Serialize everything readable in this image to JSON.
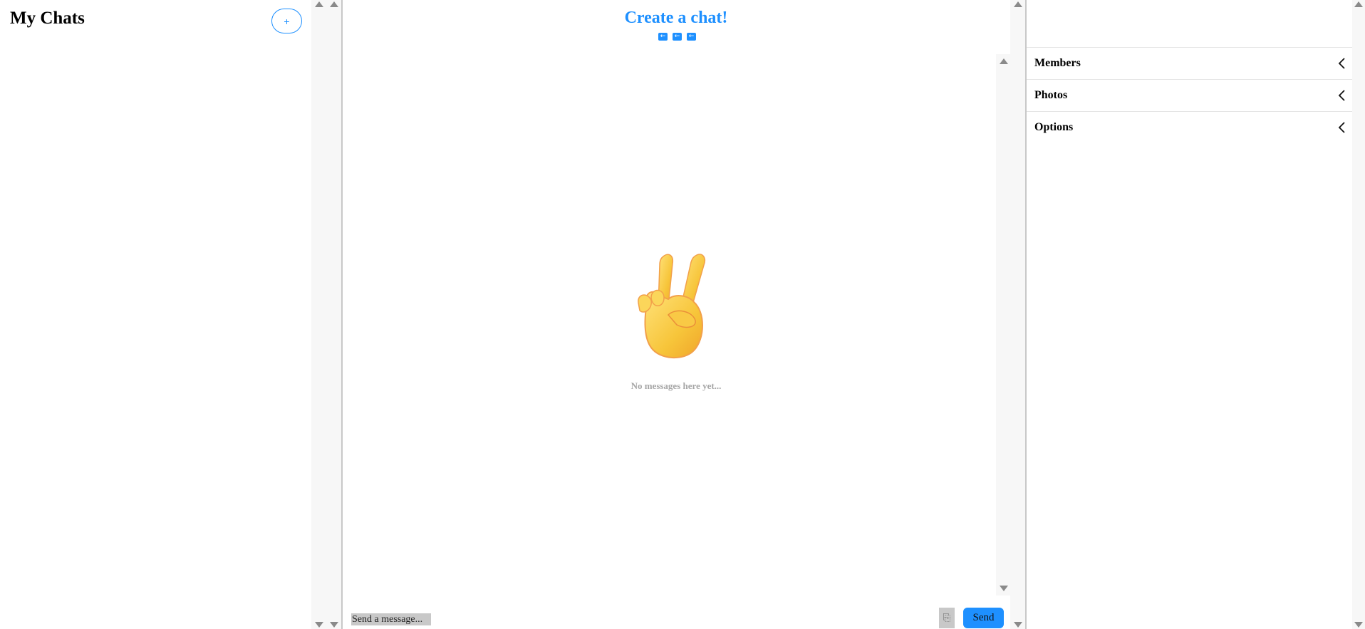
{
  "sidebar": {
    "title": "My Chats",
    "add_label": "+"
  },
  "chat": {
    "title": "Create a chat!",
    "nav_arrows": [
      "←",
      "←",
      "←"
    ],
    "empty_emoji": "victory-hand",
    "empty_text": "No messages here yet...",
    "input_placeholder": "Send a message...",
    "attach_label": "⎘",
    "send_label": "Send"
  },
  "details": {
    "sections": [
      {
        "label": "Members"
      },
      {
        "label": "Photos"
      },
      {
        "label": "Options"
      }
    ]
  },
  "colors": {
    "accent": "#1e90ff",
    "muted_text": "#a6a6a6",
    "divider": "#c8c8c8"
  }
}
